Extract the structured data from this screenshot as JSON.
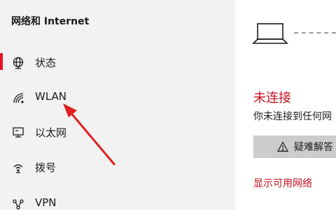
{
  "sidebar": {
    "title": "网络和 Internet",
    "items": [
      {
        "label": "状态"
      },
      {
        "label": "WLAN"
      },
      {
        "label": "以太网"
      },
      {
        "label": "拨号"
      },
      {
        "label": "VPN"
      }
    ]
  },
  "main": {
    "status_title": "未连接",
    "status_desc": "你未连接到任何网",
    "troubleshoot_label": "疑难解答",
    "show_networks_link": "显示可用网络"
  },
  "colors": {
    "accent": "#e81123",
    "status_red": "#c50f1f",
    "sidebar_bg": "#f2f2f2",
    "button_bg": "#cccccc",
    "annotation_arrow": "#e02020"
  },
  "icons": [
    "status-globe-icon",
    "wlan-icon",
    "ethernet-icon",
    "dialup-icon",
    "vpn-icon",
    "laptop-icon",
    "warning-icon"
  ]
}
